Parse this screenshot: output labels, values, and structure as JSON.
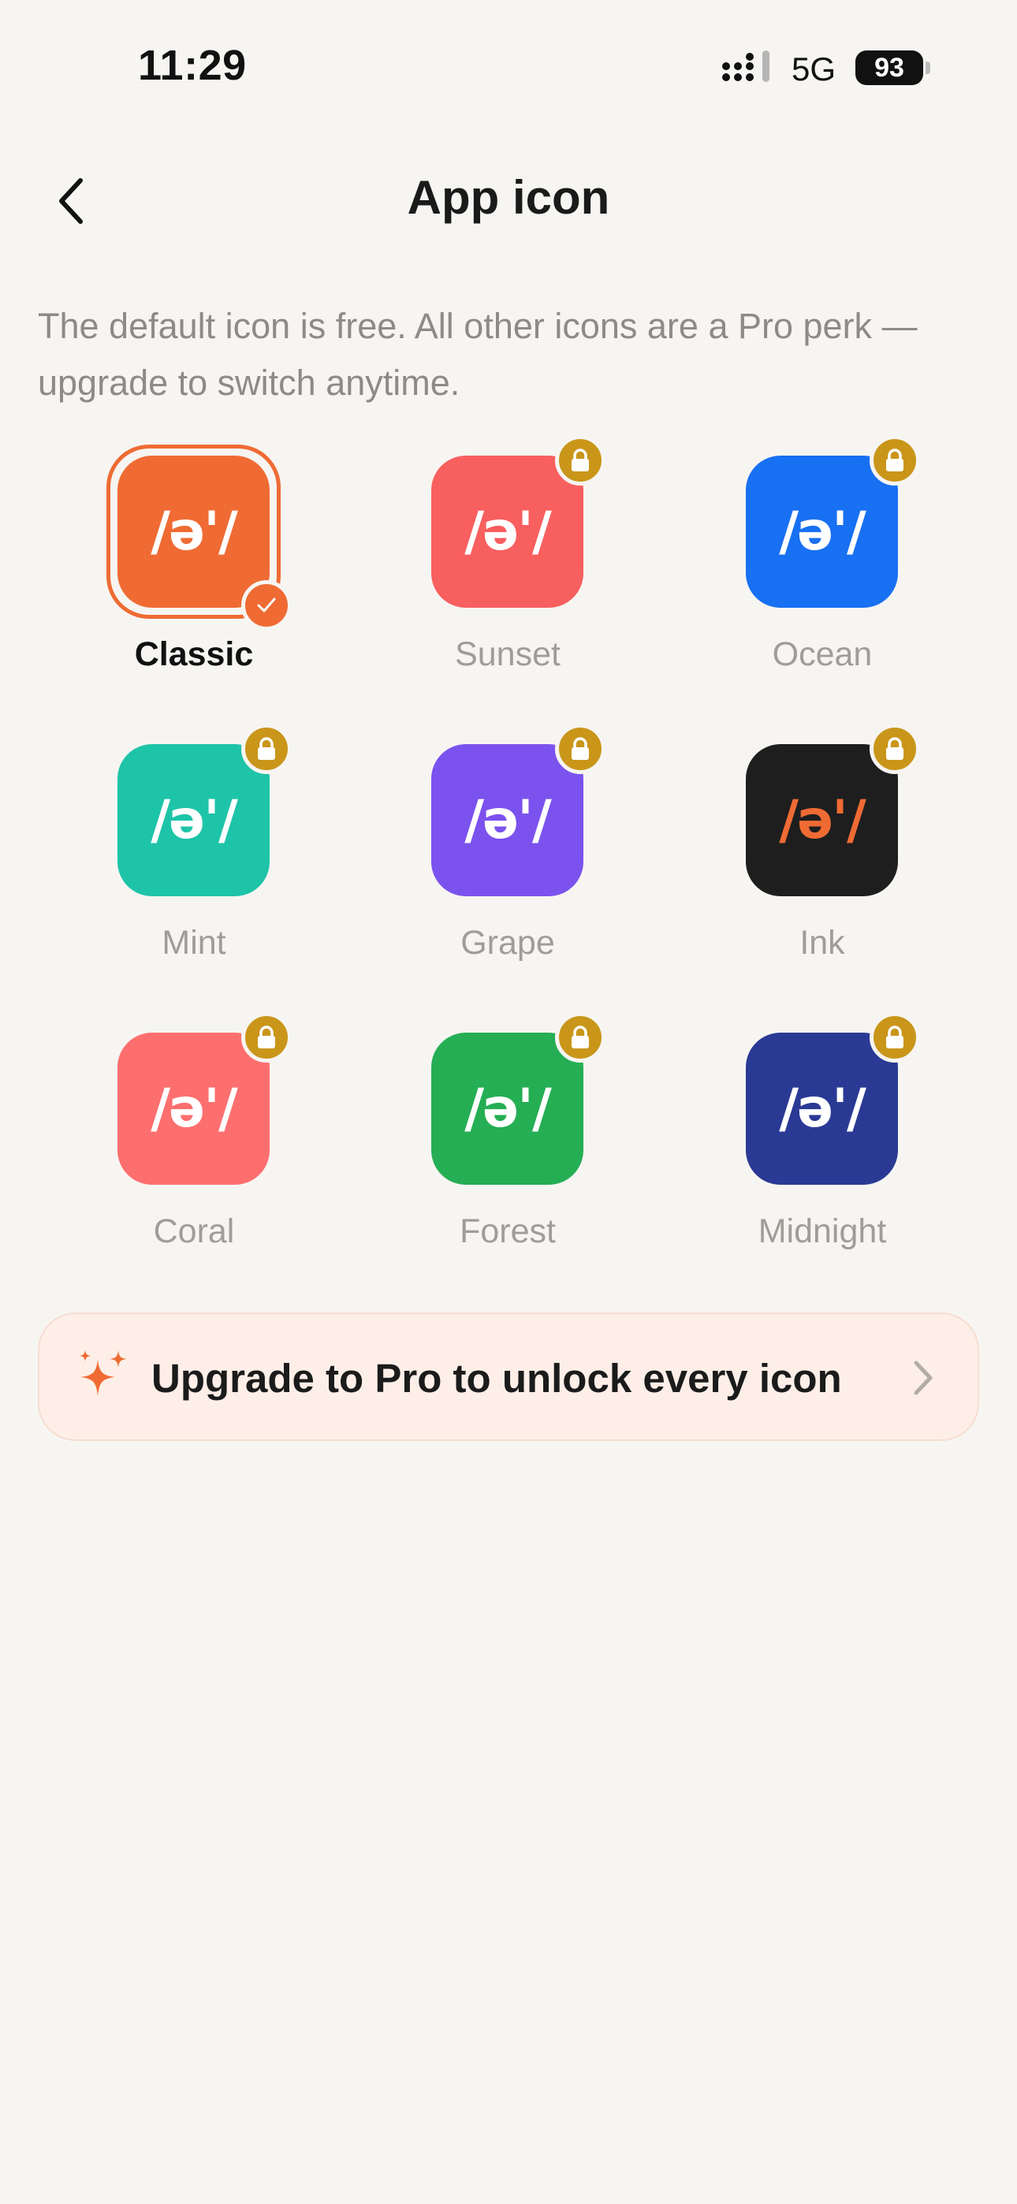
{
  "status_bar": {
    "time": "11:29",
    "network": "5G",
    "battery": "93"
  },
  "header": {
    "title": "App icon",
    "back_icon": "chevron-left-icon"
  },
  "description": "The default icon is free. All other icons are a Pro perk — upgrade to switch anytime.",
  "icon_glyph": "/ə'/",
  "icons": [
    {
      "label": "Classic",
      "selected": true,
      "locked": false,
      "bg": "#ef6b33",
      "glyph_color": "#ffffff"
    },
    {
      "label": "Sunset",
      "selected": false,
      "locked": true,
      "bg": "#f85f5f",
      "glyph_color": "#ffffff"
    },
    {
      "label": "Ocean",
      "selected": false,
      "locked": true,
      "bg": "#1870f2",
      "glyph_color": "#ffffff"
    },
    {
      "label": "Mint",
      "selected": false,
      "locked": true,
      "bg": "#1ec4a8",
      "glyph_color": "#ffffff"
    },
    {
      "label": "Grape",
      "selected": false,
      "locked": true,
      "bg": "#7b52ee",
      "glyph_color": "#ffffff"
    },
    {
      "label": "Ink",
      "selected": false,
      "locked": true,
      "bg": "#1e1e1f",
      "glyph_color": "#ef6b33"
    },
    {
      "label": "Coral",
      "selected": false,
      "locked": true,
      "bg": "#fd6f6f",
      "glyph_color": "#ffffff"
    },
    {
      "label": "Forest",
      "selected": false,
      "locked": true,
      "bg": "#25ae54",
      "glyph_color": "#ffffff"
    },
    {
      "label": "Midnight",
      "selected": false,
      "locked": true,
      "bg": "#2a3a94",
      "glyph_color": "#ffffff"
    }
  ],
  "upgrade": {
    "label": "Upgrade to Pro to unlock every icon",
    "icon": "sparkle-icon",
    "accent": "#ef6b33"
  },
  "colors": {
    "accent": "#ef6b33",
    "lock_badge": "#c9961a",
    "background": "#f7f5f2"
  }
}
